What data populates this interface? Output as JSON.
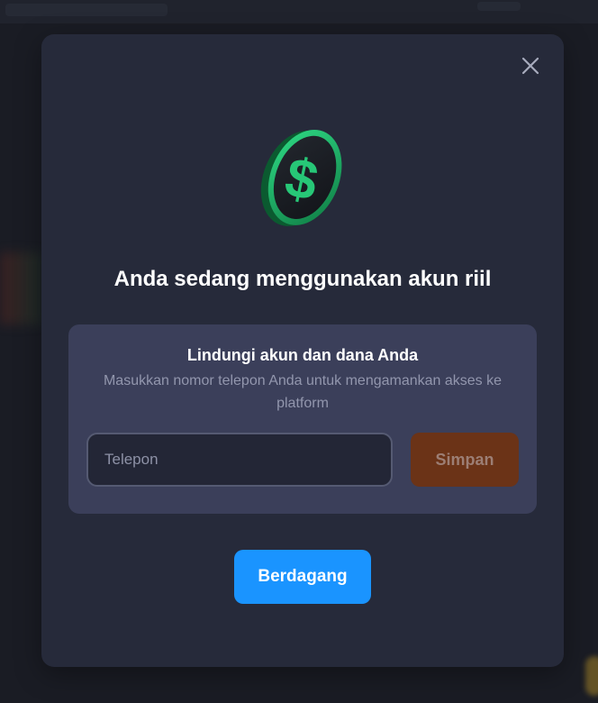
{
  "modal": {
    "title": "Anda sedang menggunakan akun riil",
    "close_icon": "close-icon",
    "coin_icon": "dollar-coin-icon"
  },
  "protect_card": {
    "title": "Lindungi akun dan dana Anda",
    "description": "Masukkan nomor telepon Anda untuk mengamankan akses ke platform",
    "phone_input": {
      "value": "",
      "placeholder": "Telepon"
    },
    "save_label": "Simpan"
  },
  "trade_label": "Berdagang",
  "colors": {
    "primary_button": "#1a94ff",
    "save_button": "#6b3317",
    "coin_green": "#1fbf6a",
    "modal_bg": "#262a3a",
    "card_bg": "#3b3f5a"
  }
}
